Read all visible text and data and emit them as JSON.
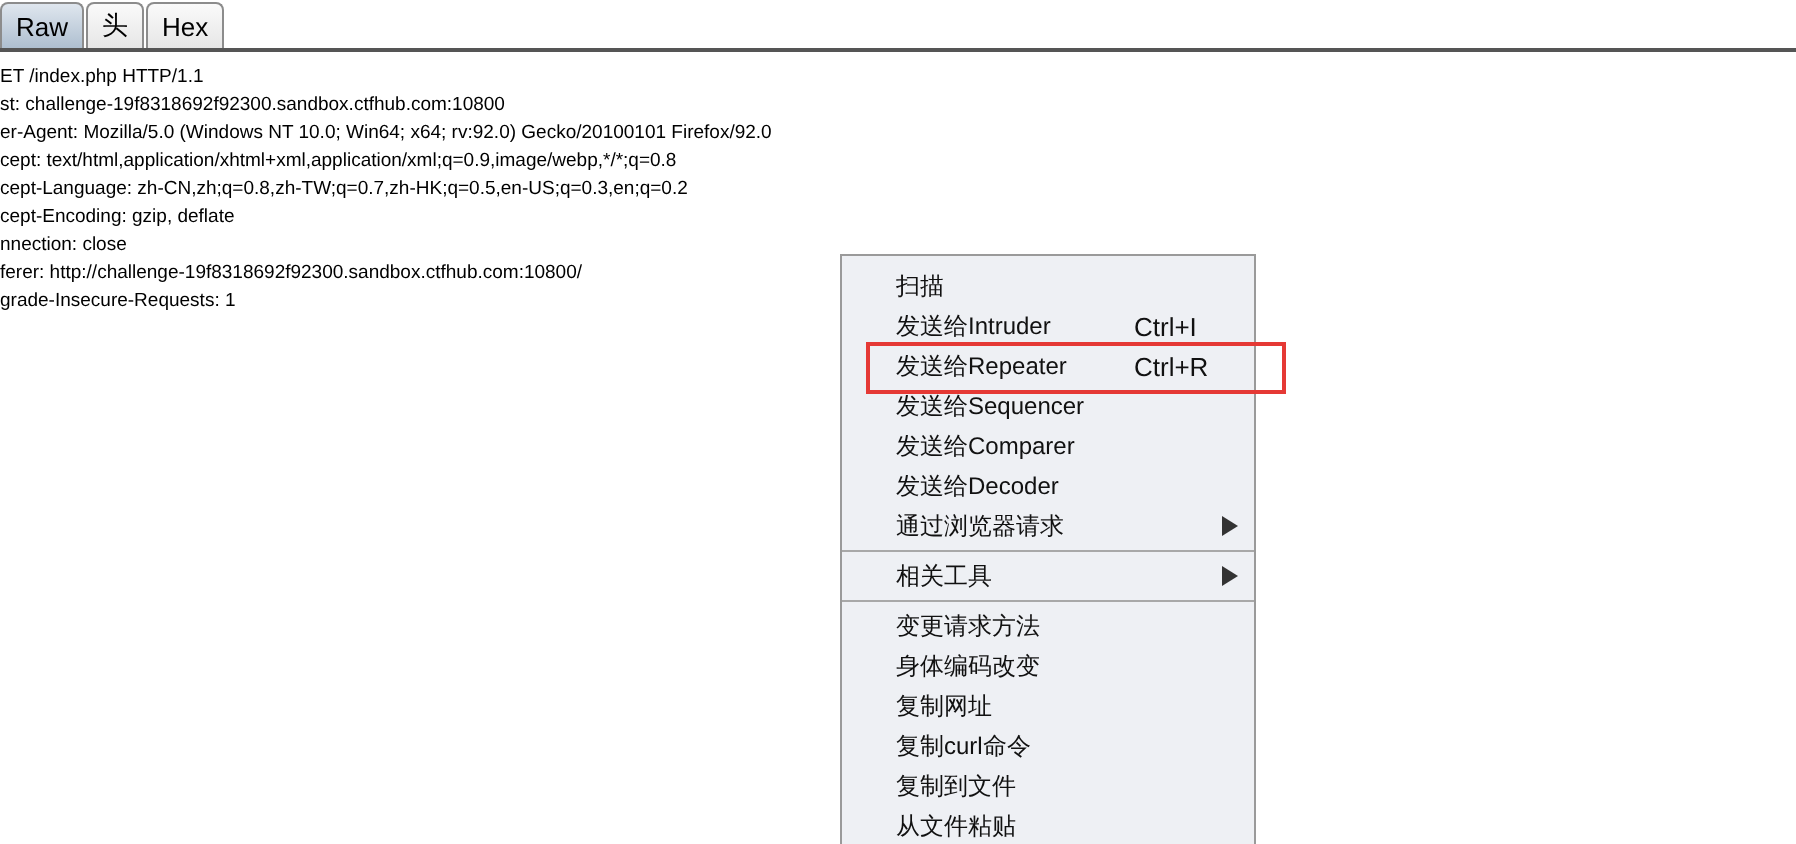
{
  "tabs": [
    {
      "label": "Raw",
      "selected": true
    },
    {
      "label": "头",
      "selected": false
    },
    {
      "label": "Hex",
      "selected": false
    }
  ],
  "request_lines": [
    "ET /index.php HTTP/1.1",
    "st: challenge-19f8318692f92300.sandbox.ctfhub.com:10800",
    "er-Agent: Mozilla/5.0 (Windows NT 10.0; Win64; x64; rv:92.0) Gecko/20100101 Firefox/92.0",
    "cept: text/html,application/xhtml+xml,application/xml;q=0.9,image/webp,*/*;q=0.8",
    "cept-Language: zh-CN,zh;q=0.8,zh-TW;q=0.7,zh-HK;q=0.5,en-US;q=0.3,en;q=0.2",
    "cept-Encoding: gzip, deflate",
    "nnection: close",
    "ferer: http://challenge-19f8318692f92300.sandbox.ctfhub.com:10800/",
    "grade-Insecure-Requests: 1"
  ],
  "context_menu": [
    {
      "kind": "item",
      "label": "扫描",
      "has_submenu": false,
      "highlighted": false
    },
    {
      "kind": "item",
      "label": "发送给Intruder",
      "shortcut": "Ctrl+I",
      "has_submenu": false,
      "highlighted": false
    },
    {
      "kind": "item",
      "label": "发送给Repeater",
      "shortcut": "Ctrl+R",
      "has_submenu": false,
      "highlighted": true
    },
    {
      "kind": "item",
      "label": "发送给Sequencer",
      "has_submenu": false,
      "highlighted": false
    },
    {
      "kind": "item",
      "label": "发送给Comparer",
      "has_submenu": false,
      "highlighted": false
    },
    {
      "kind": "item",
      "label": "发送给Decoder",
      "has_submenu": false,
      "highlighted": false
    },
    {
      "kind": "item",
      "label": "通过浏览器请求",
      "has_submenu": true,
      "highlighted": false
    },
    {
      "kind": "separator"
    },
    {
      "kind": "item",
      "label": "相关工具",
      "has_submenu": true,
      "highlighted": false
    },
    {
      "kind": "separator"
    },
    {
      "kind": "item",
      "label": "变更请求方法",
      "has_submenu": false,
      "highlighted": false
    },
    {
      "kind": "item",
      "label": "身体编码改变",
      "has_submenu": false,
      "highlighted": false
    },
    {
      "kind": "item",
      "label": "复制网址",
      "has_submenu": false,
      "highlighted": false
    },
    {
      "kind": "item",
      "label": "复制curl命令",
      "has_submenu": false,
      "highlighted": false
    },
    {
      "kind": "item",
      "label": "复制到文件",
      "has_submenu": false,
      "highlighted": false
    },
    {
      "kind": "item",
      "label": "从文件粘贴",
      "has_submenu": false,
      "highlighted": false
    }
  ]
}
